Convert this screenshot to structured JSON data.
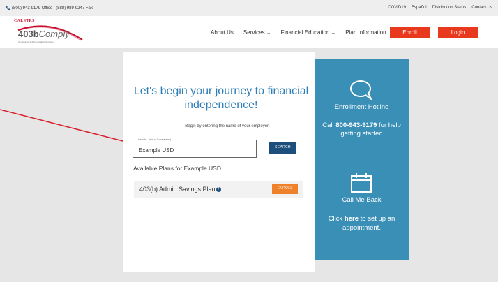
{
  "topbar": {
    "contact": "(800) 943-9179 Office | (888) 989-9247 Fax",
    "links": [
      "COVID19",
      "Español",
      "Distribution Status",
      "Contact Us"
    ]
  },
  "header": {
    "logo_org": "CALSTRS",
    "logo_brand_bold": "403b",
    "logo_brand_italic": "Comply",
    "logo_tagline": "Compliance & Administration Services",
    "nav": [
      "About Us",
      "Services ⌄",
      "Financial Education ⌄",
      "Plan Information"
    ],
    "enroll_label": "Enroll",
    "login_label": "Login",
    "accent": "#e8391f"
  },
  "main": {
    "headline": "Let's begin your journey to financial independence!",
    "subtext": "Begin by entering the name of your employer:",
    "search_label": "Search... (min of 3 characters)",
    "search_value": "Example USD",
    "search_button": "SEARCH",
    "plans_title": "Available Plans for Example USD",
    "plans": [
      {
        "name": "403(b) Admin Savings Plan",
        "info_icon": "info-icon",
        "button": "ENROLL"
      }
    ]
  },
  "side": {
    "hotline_title": "Enrollment Hotline",
    "hotline_call": "Call ",
    "hotline_phone": "800-943-9179",
    "hotline_suffix": " for help getting started",
    "callback_title": "Call Me Back",
    "callback_prefix": "Click ",
    "callback_here": "here",
    "callback_suffix": " to set up an appointment.",
    "background": "#3a8fb7"
  }
}
